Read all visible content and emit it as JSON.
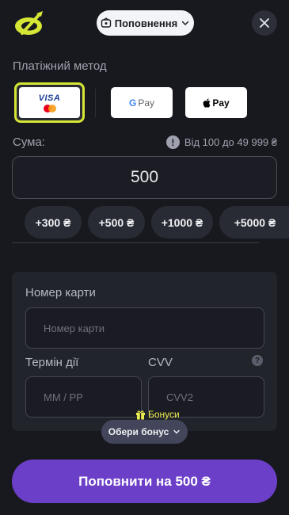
{
  "header": {
    "title": "Поповнення"
  },
  "payment": {
    "label": "Платіжний метод",
    "methods": [
      {
        "name": "VISA",
        "selected": true
      },
      {
        "name": "G Pay",
        "selected": false
      },
      {
        "name": "Pay",
        "selected": false
      }
    ]
  },
  "amount": {
    "label": "Сума:",
    "range": "Від 100 до 49 999 ₴",
    "value": "500",
    "quick": [
      "+300 ₴",
      "+500 ₴",
      "+1000 ₴",
      "+5000 ₴"
    ]
  },
  "card": {
    "number_label": "Номер карти",
    "number_placeholder": "Номер карти",
    "expiry_label": "Термін дії",
    "expiry_placeholder": "ММ / РР",
    "cvv_label": "CVV",
    "cvv_placeholder": "CVV2"
  },
  "bonus": {
    "tag": "Бонуси",
    "button": "Обери бонус"
  },
  "submit": {
    "label": "Поповнити на 500 ₴"
  },
  "colors": {
    "background": "#18191f",
    "accent_yellow": "#d5e635",
    "primary_purple": "#6c3fc9"
  }
}
